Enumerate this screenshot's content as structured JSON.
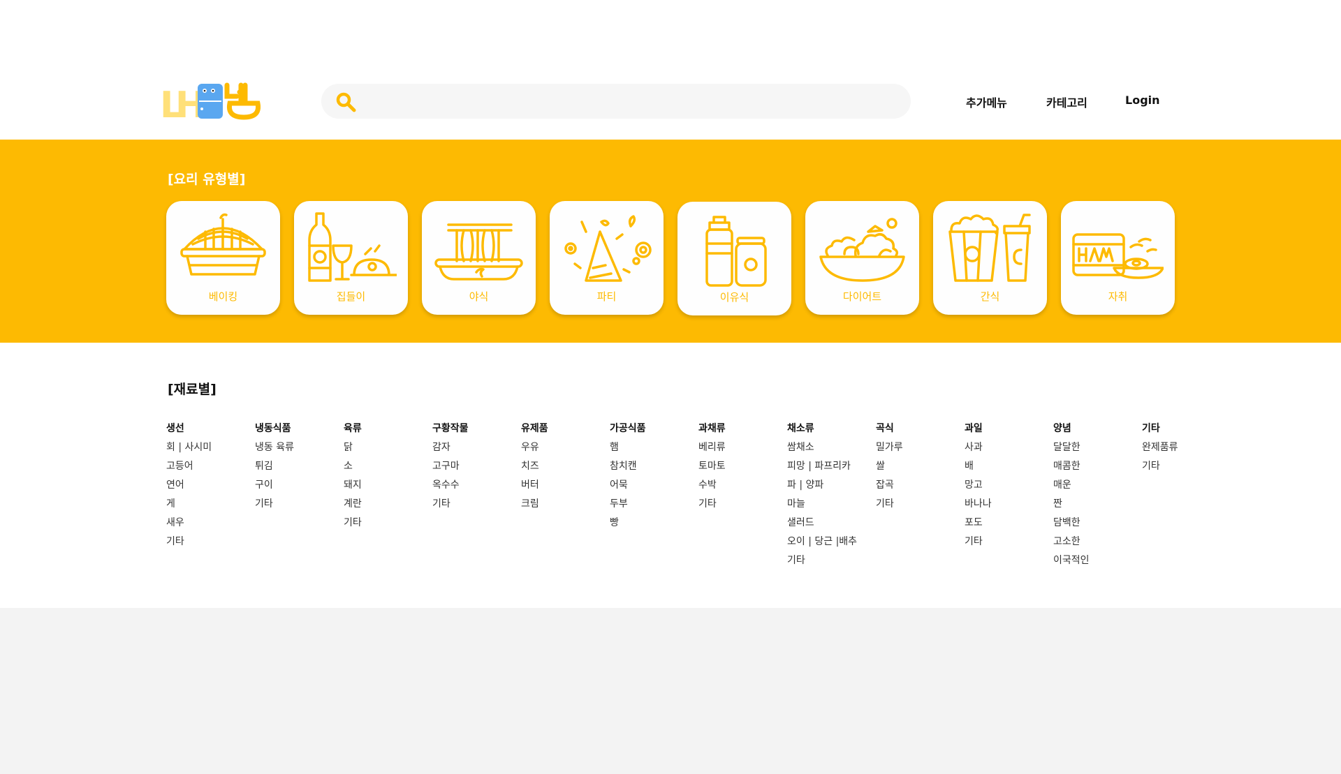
{
  "header": {
    "logo_text": "내냉",
    "search_placeholder": "",
    "nav": [
      "추가메뉴",
      "카테고리",
      "Login"
    ]
  },
  "colors": {
    "accent": "#fdba02",
    "background": "#f3f3f3",
    "card": "#fefefe"
  },
  "cooking_types": {
    "title": "[요리 유형별]",
    "items": [
      {
        "label": "베이킹",
        "icon": "pie-icon"
      },
      {
        "label": "집들이",
        "icon": "wine-party-icon"
      },
      {
        "label": "야식",
        "icon": "noodle-icon"
      },
      {
        "label": "파티",
        "icon": "party-icon"
      },
      {
        "label": "이유식",
        "icon": "baby-food-icon"
      },
      {
        "label": "다이어트",
        "icon": "salad-icon"
      },
      {
        "label": "간식",
        "icon": "popcorn-drink-icon"
      },
      {
        "label": "자취",
        "icon": "ham-egg-icon"
      }
    ]
  },
  "ingredients": {
    "title": "[재료별]",
    "categories": [
      {
        "name": "생선",
        "items": [
          "회 | 사시미",
          "고등어",
          "연어",
          "게",
          "새우",
          "기타"
        ]
      },
      {
        "name": "냉동식품",
        "items": [
          "냉동 육류",
          "튀김",
          "구이",
          "기타"
        ]
      },
      {
        "name": "육류",
        "items": [
          "닭",
          "소",
          "돼지",
          "계란",
          "기타"
        ]
      },
      {
        "name": "구황작물",
        "items": [
          "감자",
          "고구마",
          "옥수수",
          "기타"
        ]
      },
      {
        "name": "유제품",
        "items": [
          "우유",
          "치즈",
          "버터",
          "크림"
        ]
      },
      {
        "name": "가공식품",
        "items": [
          "햄",
          "참치캔",
          "어묵",
          "두부",
          "빵"
        ]
      },
      {
        "name": "과채류",
        "items": [
          "베리류",
          "토마토",
          "수박",
          "기타"
        ]
      },
      {
        "name": "채소류",
        "items": [
          "쌈채소",
          "피망 | 파프리카",
          "파 | 양파",
          "마늘",
          "샐러드",
          "오이 | 당근 |배추",
          "기타"
        ]
      },
      {
        "name": "곡식",
        "items": [
          "밀가루",
          "쌀",
          "잡곡",
          "기타"
        ]
      },
      {
        "name": "과일",
        "items": [
          "사과",
          "배",
          "망고",
          "바나나",
          "포도",
          "기타"
        ]
      },
      {
        "name": "양념",
        "items": [
          "달달한",
          "매콤한",
          "매운",
          "짠",
          "담백한",
          "고소한",
          "이국적인"
        ]
      },
      {
        "name": "기타",
        "items": [
          "완제품류",
          "기타"
        ]
      }
    ]
  }
}
